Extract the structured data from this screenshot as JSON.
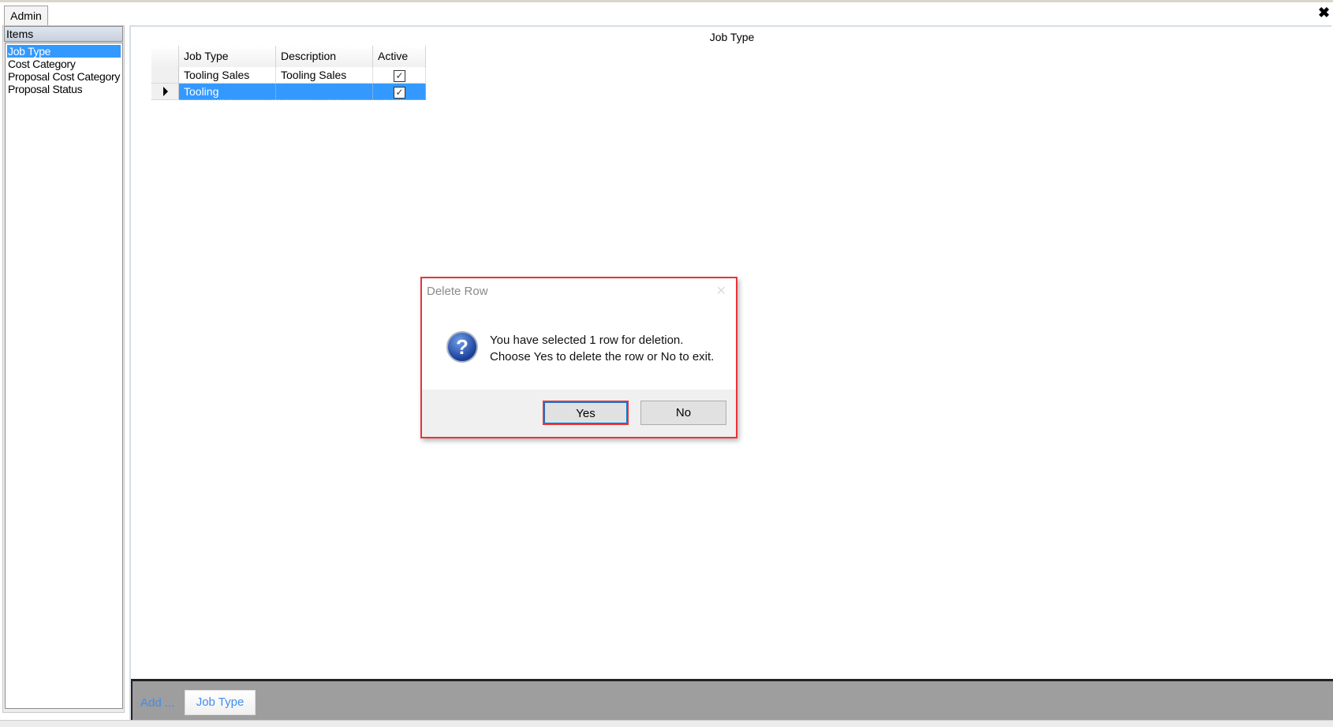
{
  "tabs": [
    {
      "label": "Admin"
    }
  ],
  "window": {
    "close_icon": "close-icon"
  },
  "sidebar": {
    "header": "Items",
    "items": [
      {
        "label": "Job Type",
        "selected": true
      },
      {
        "label": "Cost Category"
      },
      {
        "label": "Proposal Cost Category"
      },
      {
        "label": "Proposal Status"
      }
    ]
  },
  "main": {
    "title": "Job Type",
    "grid": {
      "columns": [
        "Job Type",
        "Description",
        "Active"
      ],
      "rows": [
        {
          "job_type": "Tooling Sales",
          "description": "Tooling Sales",
          "active": true,
          "selected": false
        },
        {
          "job_type": "Tooling",
          "description": "",
          "active": true,
          "selected": true
        }
      ]
    },
    "bottom": {
      "add_label": "Add ...",
      "job_type_button": "Job Type"
    }
  },
  "dialog": {
    "title": "Delete Row",
    "message_line1": "You have selected 1 row for deletion.",
    "message_line2": "Choose Yes to delete the row or No to exit.",
    "icon": "question-icon",
    "yes_label": "Yes",
    "no_label": "No"
  },
  "colors": {
    "selection": "#3399ff",
    "highlight": "#e8343c",
    "link": "#3d8ef0"
  }
}
